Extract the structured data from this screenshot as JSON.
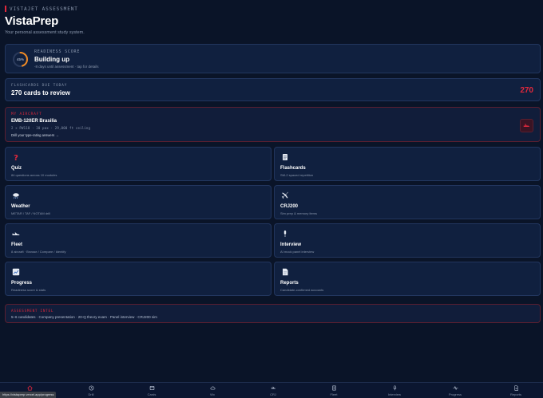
{
  "header": {
    "eyebrow": "VISTAJET ASSESSMENT",
    "title": "VistaPrep",
    "subtitle": "Your personal assessment study system."
  },
  "readiness": {
    "label": "READINESS SCORE",
    "percent": 45,
    "percent_label": "45%",
    "title": "Building up",
    "subtitle": "-8 days until assessment · tap for details"
  },
  "flashcards_due": {
    "label": "FLASHCARDS DUE TODAY",
    "title": "270 cards to review",
    "count": "270"
  },
  "aircraft": {
    "label": "MY AIRCRAFT",
    "title": "EMB-120ER Brasilia",
    "specs": "2 × PW118 · 30 pax · 29,000 ft ceiling",
    "link": "Drill your type-rating answers →"
  },
  "modules": [
    {
      "title": "Quiz",
      "subtitle": "84 questions across 10 modules",
      "icon": "question-icon"
    },
    {
      "title": "Flashcards",
      "subtitle": "SM-2 spaced repetition",
      "icon": "cards-icon"
    },
    {
      "title": "Weather",
      "subtitle": "METAR / TAF / NOTAM drill",
      "icon": "weather-icon"
    },
    {
      "title": "CRJ200",
      "subtitle": "Sim prep & memory items",
      "icon": "plane-icon"
    },
    {
      "title": "Fleet",
      "subtitle": "8 aircraft · Browse / Compare / Identify",
      "icon": "fleet-icon"
    },
    {
      "title": "Interview",
      "subtitle": "AI mock panel interview",
      "icon": "mic-icon"
    },
    {
      "title": "Progress",
      "subtitle": "Readiness score & stats",
      "icon": "chart-icon"
    },
    {
      "title": "Reports",
      "subtitle": "Candidate-confirmed accounts",
      "icon": "document-icon"
    }
  ],
  "intel": {
    "label": "ASSESSMENT INTEL",
    "text": "5–6 candidates · Company presentation · 20-Q theory exam · Panel interview · CRJ200 sim"
  },
  "nav": [
    {
      "label": "Home",
      "icon": "home-icon",
      "active": true
    },
    {
      "label": "Drill",
      "icon": "clock-icon"
    },
    {
      "label": "Cards",
      "icon": "cards-icon"
    },
    {
      "label": "Wx",
      "icon": "weather-icon"
    },
    {
      "label": "CRJ",
      "icon": "plane-icon"
    },
    {
      "label": "Fleet",
      "icon": "fleet-icon"
    },
    {
      "label": "Interview",
      "icon": "mic-icon"
    },
    {
      "label": "Progress",
      "icon": "pulse-icon"
    },
    {
      "label": "Reports",
      "icon": "document-icon"
    }
  ],
  "status_url": "https://vistaprep.vercel.app/progress",
  "colors": {
    "accent": "#e1283c",
    "ring": "#f08a24",
    "card": "#10203f",
    "background": "#0a1428"
  }
}
